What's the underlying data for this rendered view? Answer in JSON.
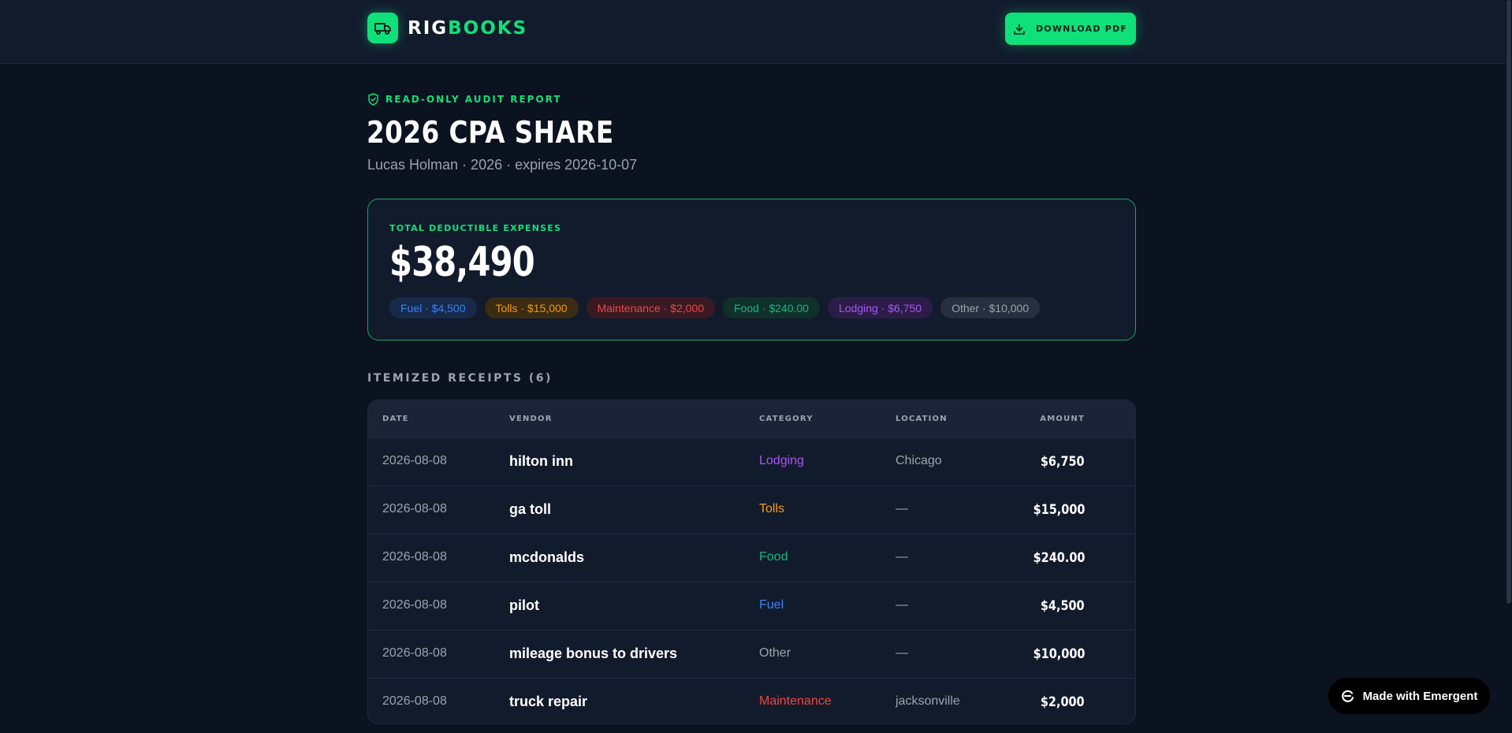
{
  "header": {
    "brand_part1": "RIG",
    "brand_part2": "BOOKS",
    "download_label": "DOWNLOAD PDF"
  },
  "report": {
    "badge": "READ-ONLY AUDIT REPORT",
    "title": "2026 CPA SHARE",
    "subtitle": "Lucas Holman · 2026 · expires 2026-10-07"
  },
  "summary": {
    "label": "TOTAL DEDUCTIBLE EXPENSES",
    "total": "$38,490",
    "chips": [
      {
        "label": "Fuel · $4,500",
        "color": "#3b82f6",
        "bg": "#172a4a"
      },
      {
        "label": "Tolls · $15,000",
        "color": "#f59e0b",
        "bg": "#3a2b12"
      },
      {
        "label": "Maintenance · $2,000",
        "color": "#ef4444",
        "bg": "#3a1a22"
      },
      {
        "label": "Food · $240.00",
        "color": "#10b981",
        "bg": "#10302a"
      },
      {
        "label": "Lodging · $6,750",
        "color": "#a855f7",
        "bg": "#2b1d48"
      },
      {
        "label": "Other · $10,000",
        "color": "#9ca3af",
        "bg": "#262f3d"
      }
    ]
  },
  "receipts": {
    "title": "ITEMIZED RECEIPTS (6)",
    "columns": [
      "DATE",
      "VENDOR",
      "CATEGORY",
      "LOCATION",
      "AMOUNT"
    ],
    "rows": [
      {
        "date": "2026-08-08",
        "vendor": "hilton inn",
        "category": "Lodging",
        "cat_color": "#a855f7",
        "location": "Chicago",
        "amount": "$6,750"
      },
      {
        "date": "2026-08-08",
        "vendor": "ga toll",
        "category": "Tolls",
        "cat_color": "#f59e0b",
        "location": "—",
        "amount": "$15,000"
      },
      {
        "date": "2026-08-08",
        "vendor": "mcdonalds",
        "category": "Food",
        "cat_color": "#10b981",
        "location": "—",
        "amount": "$240.00"
      },
      {
        "date": "2026-08-08",
        "vendor": "pilot",
        "category": "Fuel",
        "cat_color": "#3b82f6",
        "location": "—",
        "amount": "$4,500"
      },
      {
        "date": "2026-08-08",
        "vendor": "mileage bonus to drivers",
        "category": "Other",
        "cat_color": "#9ca3af",
        "location": "—",
        "amount": "$10,000"
      },
      {
        "date": "2026-08-08",
        "vendor": "truck repair",
        "category": "Maintenance",
        "cat_color": "#ef4444",
        "location": "jacksonville",
        "amount": "$2,000"
      }
    ]
  },
  "footer": {
    "badge_label": "Made with Emergent"
  }
}
